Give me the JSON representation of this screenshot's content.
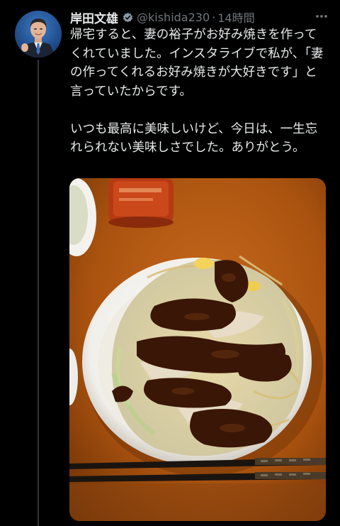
{
  "tweet": {
    "author": {
      "display_name": "岸田文雄",
      "handle": "@kishida230"
    },
    "separator": "·",
    "time": "14時間",
    "body": "帰宅すると、妻の裕子がお好み焼きを作ってくれていました。インスタライブで私が、「妻の作ってくれるお好み焼きが大好きです」と言っていたからです。\n\nいつも最高に美味しいけど、今日は、一生忘れられない美味しさでした。ありがとう。"
  },
  "icons": {
    "verified": "verified-badge-icon",
    "more": "more-horizontal-icon"
  },
  "colors": {
    "background": "#000000",
    "text_primary": "#e7e9ea",
    "text_secondary": "#71767b",
    "verified": "#8b98a5",
    "thread_line": "#333639"
  }
}
